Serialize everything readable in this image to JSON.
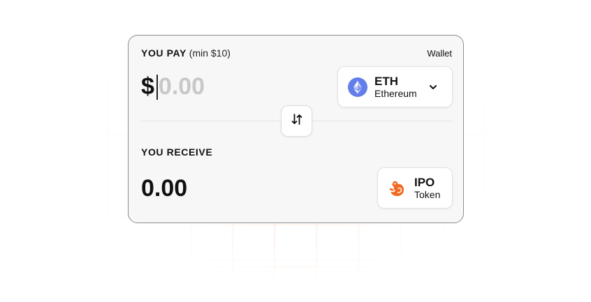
{
  "pay": {
    "label": "YOU PAY",
    "min_note": "(min $10)",
    "wallet_label": "Wallet",
    "currency_symbol": "$",
    "amount_placeholder": "0.00",
    "amount_value": ""
  },
  "pay_token": {
    "symbol": "ETH",
    "name": "Ethereum",
    "icon": "ethereum-icon",
    "icon_color": "#627EEA"
  },
  "swap": {
    "icon": "swap-arrows-icon"
  },
  "receive": {
    "label": "YOU RECEIVE",
    "amount": "0.00"
  },
  "receive_token": {
    "symbol": "IPO",
    "name": "Token",
    "icon": "ipo-token-icon",
    "icon_color": "#F26A21"
  }
}
